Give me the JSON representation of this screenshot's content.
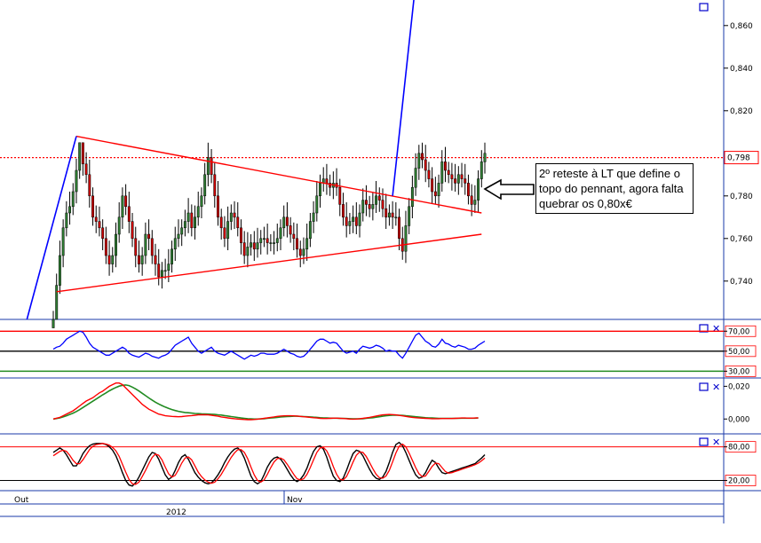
{
  "annotation": "2º reteste à LT que define o topo do pennant, agora falta quebrar os 0,80x€",
  "x_axis": {
    "labels": [
      "Out",
      "Nov"
    ],
    "year": "2012"
  },
  "colors": {
    "candle_up": "#2e7d32",
    "candle_down": "#cc0000",
    "trend": "#ff0000",
    "impulse": "#0000ff",
    "rsi": "#0000ff",
    "ma_fast": "#ff0000",
    "ma_slow": "#228b22",
    "stoch_k": "#000000",
    "stoch_d": "#ff0000",
    "reference_line": "#ff0000"
  },
  "chart_data": [
    {
      "type": "candlestick",
      "panel": "price",
      "ylim": [
        0.722,
        0.872
      ],
      "y_ticks": [
        "0,740",
        "0,760",
        "0,780",
        "0,820",
        "0,840",
        "0,860"
      ],
      "last_price_label": "0,798",
      "reference_line": 0.798,
      "closes": [
        0.722,
        0.738,
        0.752,
        0.765,
        0.772,
        0.775,
        0.782,
        0.792,
        0.805,
        0.795,
        0.79,
        0.78,
        0.77,
        0.768,
        0.765,
        0.76,
        0.752,
        0.748,
        0.752,
        0.762,
        0.77,
        0.78,
        0.775,
        0.768,
        0.76,
        0.752,
        0.748,
        0.752,
        0.762,
        0.76,
        0.752,
        0.748,
        0.742,
        0.745,
        0.745,
        0.748,
        0.755,
        0.76,
        0.762,
        0.765,
        0.768,
        0.772,
        0.765,
        0.77,
        0.775,
        0.78,
        0.79,
        0.798,
        0.79,
        0.78,
        0.77,
        0.765,
        0.76,
        0.768,
        0.772,
        0.77,
        0.765,
        0.758,
        0.752,
        0.756,
        0.758,
        0.755,
        0.758,
        0.76,
        0.76,
        0.758,
        0.758,
        0.758,
        0.76,
        0.765,
        0.77,
        0.766,
        0.762,
        0.76,
        0.755,
        0.752,
        0.755,
        0.76,
        0.768,
        0.772,
        0.78,
        0.786,
        0.788,
        0.786,
        0.784,
        0.786,
        0.784,
        0.776,
        0.77,
        0.766,
        0.768,
        0.77,
        0.766,
        0.772,
        0.778,
        0.776,
        0.774,
        0.776,
        0.78,
        0.778,
        0.774,
        0.77,
        0.772,
        0.77,
        0.77,
        0.76,
        0.754,
        0.766,
        0.775,
        0.784,
        0.793,
        0.8,
        0.797,
        0.792,
        0.788,
        0.782,
        0.78,
        0.786,
        0.796,
        0.792,
        0.79,
        0.788,
        0.786,
        0.79,
        0.788,
        0.786,
        0.78,
        0.776,
        0.778,
        0.788,
        0.796,
        0.8
      ],
      "high": 0.805,
      "low": 0.722
    },
    {
      "type": "trendlines",
      "pennant_top": [
        [
          7,
          0.808
        ],
        [
          130,
          0.772
        ]
      ],
      "pennant_bottom": [
        [
          1,
          0.735
        ],
        [
          130,
          0.762
        ]
      ],
      "impulse_line": [
        [
          -8,
          0.722
        ],
        [
          7,
          0.808
        ]
      ],
      "breakout_line": [
        [
          103,
          0.78
        ],
        [
          110,
          0.88
        ]
      ]
    },
    {
      "type": "line",
      "panel": "rsi",
      "ylim": [
        25,
        80
      ],
      "y_ticks": [
        "70,00",
        "50,00",
        "30,00"
      ],
      "levels": [
        70,
        50,
        30
      ],
      "values": [
        52,
        54,
        55,
        58,
        62,
        64,
        66,
        68,
        70,
        69,
        64,
        58,
        54,
        52,
        50,
        48,
        46,
        46,
        48,
        50,
        52,
        54,
        52,
        48,
        46,
        45,
        44,
        46,
        48,
        47,
        45,
        44,
        43,
        45,
        46,
        48,
        52,
        56,
        58,
        60,
        62,
        64,
        58,
        54,
        50,
        48,
        50,
        52,
        54,
        50,
        48,
        47,
        46,
        48,
        50,
        48,
        46,
        44,
        42,
        44,
        46,
        45,
        46,
        48,
        48,
        47,
        47,
        47,
        48,
        50,
        52,
        50,
        48,
        47,
        45,
        44,
        45,
        48,
        52,
        56,
        60,
        62,
        62,
        60,
        58,
        59,
        58,
        54,
        50,
        48,
        49,
        50,
        48,
        52,
        55,
        54,
        53,
        54,
        56,
        55,
        53,
        50,
        51,
        50,
        50,
        46,
        43,
        48,
        54,
        60,
        66,
        68,
        64,
        60,
        58,
        55,
        54,
        57,
        62,
        58,
        57,
        55,
        54,
        56,
        55,
        54,
        52,
        52,
        53,
        56,
        58,
        60
      ]
    },
    {
      "type": "line",
      "panel": "macd",
      "ylim": [
        -0.008,
        0.024
      ],
      "y_ticks": [
        "0,020",
        "0,000"
      ],
      "series": [
        {
          "role": "fast",
          "values": [
            0,
            0.0005,
            0.001,
            0.002,
            0.003,
            0.004,
            0.005,
            0.0065,
            0.008,
            0.0095,
            0.011,
            0.012,
            0.013,
            0.0145,
            0.016,
            0.017,
            0.0185,
            0.02,
            0.021,
            0.022,
            0.022,
            0.021,
            0.019,
            0.017,
            0.015,
            0.013,
            0.011,
            0.009,
            0.0075,
            0.006,
            0.005,
            0.004,
            0.003,
            0.0025,
            0.002,
            0.0018,
            0.0016,
            0.0015,
            0.0014,
            0.0015,
            0.0017,
            0.0019,
            0.0021,
            0.0023,
            0.0025,
            0.0026,
            0.0026,
            0.0025,
            0.0023,
            0.002,
            0.0017,
            0.0013,
            0.001,
            0.0007,
            0.0004,
            0.0002,
            0,
            -0.0002,
            -0.0003,
            -0.0004,
            -0.0004,
            -0.0003,
            -0.0001,
            0.0001,
            0.0004,
            0.0007,
            0.001,
            0.0013,
            0.0016,
            0.0018,
            0.0019,
            0.002,
            0.002,
            0.0019,
            0.0018,
            0.0016,
            0.0014,
            0.0012,
            0.001,
            0.0008,
            0.0006,
            0.0004,
            0.0003,
            0.0003,
            0.0004,
            0.0005,
            0.0005,
            0.0004,
            0.0003,
            0.0002,
            0,
            -0.0001,
            0,
            0.0002,
            0.0004,
            0.0007,
            0.001,
            0.0014,
            0.0018,
            0.0022,
            0.0025,
            0.0027,
            0.0028,
            0.0027,
            0.0025,
            0.0022,
            0.0019,
            0.0016,
            0.0013,
            0.001,
            0.0008,
            0.0006,
            0.0005,
            0.0004,
            0.0003,
            0.0002,
            0.0002,
            0.0002,
            0.0003,
            0.0003,
            0.0003,
            0.0003,
            0.0004,
            0.0005,
            0.0006,
            0.0006,
            0.0005,
            0.0005,
            0.0006,
            0.0007
          ]
        },
        {
          "role": "slow",
          "values": [
            0,
            0.0003,
            0.0007,
            0.0013,
            0.002,
            0.0028,
            0.0036,
            0.0046,
            0.0057,
            0.007,
            0.0083,
            0.0096,
            0.0109,
            0.0122,
            0.0135,
            0.0148,
            0.016,
            0.0172,
            0.0183,
            0.0193,
            0.0201,
            0.0206,
            0.0208,
            0.0204,
            0.0195,
            0.0184,
            0.0171,
            0.0157,
            0.0143,
            0.0129,
            0.0116,
            0.0103,
            0.0092,
            0.0082,
            0.0073,
            0.0065,
            0.0058,
            0.0052,
            0.0047,
            0.0043,
            0.004,
            0.0038,
            0.0036,
            0.0034,
            0.0033,
            0.0032,
            0.0031,
            0.003,
            0.0029,
            0.0028,
            0.0026,
            0.0024,
            0.0021,
            0.0018,
            0.0015,
            0.0012,
            0.0009,
            0.0006,
            0.0004,
            0.0002,
            0.0001,
            0,
            0,
            0.0001,
            0.0002,
            0.0004,
            0.0006,
            0.0008,
            0.001,
            0.0012,
            0.0014,
            0.0015,
            0.0016,
            0.0017,
            0.0017,
            0.0016,
            0.0015,
            0.0014,
            0.0013,
            0.0011,
            0.001,
            0.0008,
            0.0007,
            0.0006,
            0.0005,
            0.0005,
            0.0005,
            0.0004,
            0.0004,
            0.0003,
            0.0002,
            0.0001,
            0.0001,
            0.0001,
            0.0002,
            0.0004,
            0.0006,
            0.0008,
            0.0011,
            0.0014,
            0.0017,
            0.002,
            0.0022,
            0.0023,
            0.0024,
            0.0023,
            0.0022,
            0.002,
            0.0018,
            0.0016,
            0.0014,
            0.0012,
            0.001,
            0.0008,
            0.0007,
            0.0006,
            0.0005,
            0.0004,
            0.0004,
            0.0004,
            0.0004,
            0.0004,
            0.0004,
            0.0004,
            0.0005,
            0.0005,
            0.0005,
            0.0005,
            0.0005,
            0.0006
          ]
        }
      ]
    },
    {
      "type": "line",
      "panel": "stochastic",
      "ylim": [
        5,
        100
      ],
      "y_ticks": [
        "80,00",
        "20,00"
      ],
      "levels": [
        80,
        20
      ],
      "series": [
        {
          "role": "k",
          "values": [
            70,
            74,
            78,
            74,
            66,
            56,
            46,
            46,
            56,
            68,
            76,
            82,
            85,
            86,
            86,
            86,
            84,
            80,
            74,
            64,
            50,
            34,
            20,
            12,
            10,
            16,
            26,
            38,
            50,
            62,
            70,
            68,
            58,
            44,
            30,
            22,
            26,
            38,
            52,
            62,
            66,
            58,
            46,
            34,
            26,
            20,
            16,
            14,
            16,
            22,
            30,
            40,
            52,
            62,
            70,
            76,
            78,
            72,
            60,
            44,
            28,
            18,
            14,
            18,
            30,
            44,
            54,
            60,
            62,
            58,
            50,
            40,
            30,
            22,
            18,
            22,
            30,
            42,
            58,
            72,
            80,
            82,
            76,
            62,
            44,
            28,
            20,
            18,
            24,
            38,
            54,
            68,
            74,
            72,
            64,
            52,
            40,
            30,
            24,
            22,
            26,
            36,
            52,
            70,
            84,
            88,
            82,
            70,
            56,
            42,
            30,
            24,
            26,
            34,
            46,
            56,
            52,
            42,
            34,
            32,
            34,
            36,
            38,
            40,
            42,
            44,
            46,
            48,
            50,
            55,
            60,
            66
          ]
        },
        {
          "role": "d",
          "values": [
            64,
            68,
            72,
            74,
            72,
            65,
            56,
            50,
            50,
            57,
            66,
            75,
            81,
            84,
            85,
            86,
            85,
            83,
            79,
            73,
            63,
            49,
            35,
            22,
            14,
            13,
            17,
            27,
            38,
            50,
            61,
            67,
            65,
            57,
            44,
            32,
            26,
            29,
            39,
            51,
            60,
            62,
            57,
            46,
            35,
            27,
            21,
            17,
            15,
            17,
            23,
            31,
            41,
            51,
            61,
            69,
            75,
            75,
            70,
            59,
            44,
            30,
            20,
            17,
            21,
            31,
            43,
            53,
            59,
            60,
            57,
            49,
            40,
            31,
            23,
            21,
            23,
            31,
            43,
            57,
            70,
            78,
            79,
            73,
            61,
            45,
            31,
            22,
            21,
            27,
            39,
            53,
            65,
            71,
            70,
            63,
            52,
            41,
            31,
            25,
            24,
            28,
            38,
            53,
            69,
            81,
            85,
            80,
            69,
            56,
            43,
            32,
            27,
            28,
            36,
            45,
            51,
            50,
            43,
            36,
            33,
            34,
            36,
            38,
            40,
            42,
            44,
            46,
            48,
            51,
            55,
            60
          ]
        }
      ]
    }
  ]
}
